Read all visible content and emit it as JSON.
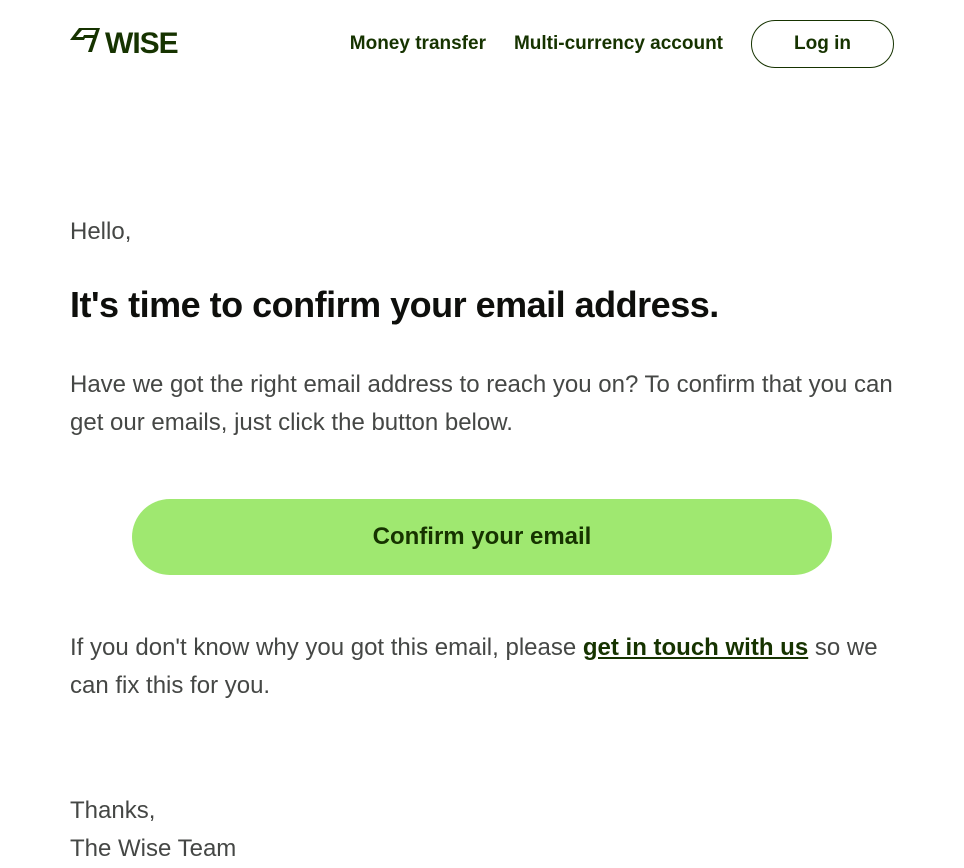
{
  "header": {
    "nav_money_transfer": "Money transfer",
    "nav_multi_currency": "Multi-currency account",
    "login_button": "Log in"
  },
  "body": {
    "greeting": "Hello,",
    "title": "It's time to confirm your email address.",
    "intro": "Have we got the right email address to reach you on? To confirm that you can get our emails, just click the button below.",
    "cta_label": "Confirm your email",
    "disclaimer_before": "If you don't know why you got this email, please ",
    "disclaimer_link": "get in touch with us",
    "disclaimer_after": " so we can fix this for you.",
    "thanks": "Thanks,",
    "team": "The Wise Team"
  }
}
